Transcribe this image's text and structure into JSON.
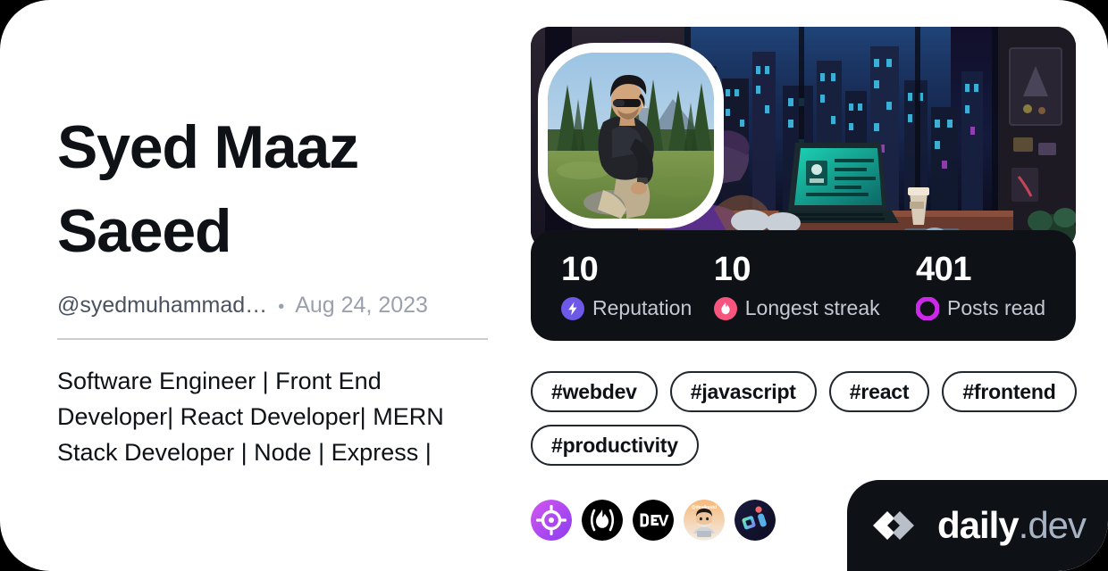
{
  "card": {
    "background_color": "#ffffff",
    "page_background": "#000000"
  },
  "profile": {
    "name": "Syed Maaz Saeed",
    "handle": "@syedmuhammad…",
    "separator_dot": "•",
    "joined_date": "Aug 24, 2023",
    "bio": "Software Engineer | Front End Developer| React Developer| MERN Stack Developer | Node | Express |"
  },
  "stats": [
    {
      "value": "10",
      "label": "Reputation",
      "icon": "lightning-bolt-icon",
      "color": "#6e58e8"
    },
    {
      "value": "10",
      "label": "Longest streak",
      "icon": "flame-icon",
      "color": "#f8557e"
    },
    {
      "value": "401",
      "label": "Posts read",
      "icon": "ring-icon",
      "color": "#cb28e8"
    }
  ],
  "tags": [
    {
      "label": "#webdev"
    },
    {
      "label": "#javascript"
    },
    {
      "label": "#react"
    },
    {
      "label": "#frontend"
    },
    {
      "label": "#productivity"
    }
  ],
  "sources": [
    {
      "name": "source-crosshair-badge",
      "icon": "crosshair-icon"
    },
    {
      "name": "source-flame-badge",
      "icon": "flame-parens-icon"
    },
    {
      "name": "source-dev-badge",
      "icon": "dev-logo-icon",
      "label": "DEV"
    },
    {
      "name": "source-memoji-badge",
      "icon": "memoji-avatar-icon"
    },
    {
      "name": "source-shapes-badge",
      "icon": "shapes-icon"
    }
  ],
  "brand": {
    "mark": "code-brackets-icon",
    "name": "daily",
    "suffix": ".dev"
  },
  "cover": {
    "alt": "cyberpunk-city-desk-scene"
  },
  "avatar": {
    "alt": "man-sitting-outdoors-portrait"
  }
}
